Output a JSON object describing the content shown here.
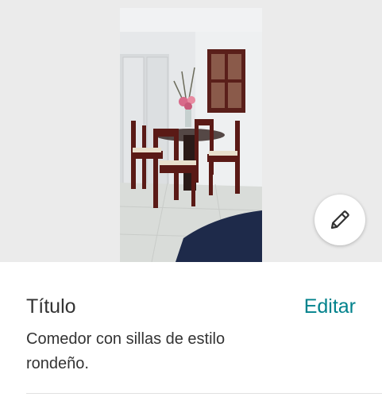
{
  "listing": {
    "title_heading": "Título",
    "edit_label": "Editar",
    "description": "Comedor con sillas de estilo rondeño."
  },
  "icons": {
    "edit_photo": "pencil-icon"
  },
  "colors": {
    "accent": "#00828c",
    "text": "#333333",
    "photo_backdrop": "#ebebeb"
  }
}
